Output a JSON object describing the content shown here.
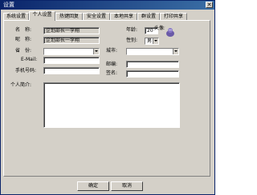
{
  "window": {
    "title": "设置",
    "close_glyph": "✕"
  },
  "tabs": [
    "系统设置",
    "个人设置",
    "热键回复",
    "安全设置",
    "本地共享",
    "群设置",
    "打印共享"
  ],
  "active_tab": "个人设置",
  "profile": {
    "name_label": "名　称:",
    "name_value": "企划部长一李翔",
    "nickname_label": "昵　称:",
    "nickname_value": "企划部长一李翔",
    "age_label": "年龄:",
    "age_value": "20",
    "avatar_label": "头像:",
    "gender_label": "性别:",
    "gender_value": "男",
    "province_label": "省　份:",
    "province_value": "",
    "city_label": "城市:",
    "city_value": "",
    "email_label": "E-Mail:",
    "email_value": "",
    "postcode_label": "邮编:",
    "postcode_value": "",
    "mobile_label": "手机号码:",
    "mobile_value": "",
    "signature_label": "签名:",
    "signature_value": "",
    "intro_label": "个人简介:",
    "intro_value": ""
  },
  "buttons": {
    "ok": "确定",
    "cancel": "取消"
  },
  "colors": {
    "title_bar": "#0a246a",
    "face": "#d4d0c8",
    "avatar": "#6a5aa8"
  },
  "icons": [
    "close-icon",
    "avatar-icon",
    "dropdown-arrow-icon"
  ]
}
